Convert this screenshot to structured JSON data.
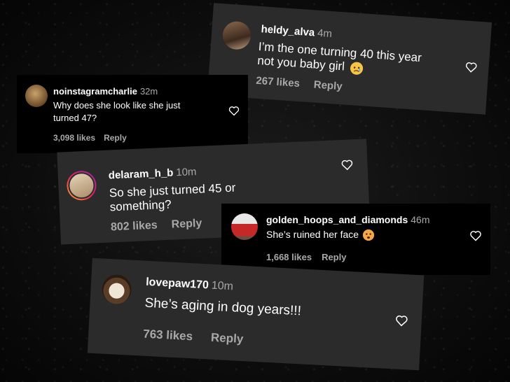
{
  "comments": [
    {
      "user": "heldy_alva",
      "time": "4m",
      "line1": "I’m the one turning 40 this year",
      "line2": "not you baby girl",
      "likes": "267 likes",
      "reply": "Reply"
    },
    {
      "user": "noinstagramcharlie",
      "time": "32m",
      "line1": "Why does she look like she just",
      "line2": "turned 47?",
      "likes": "3,098 likes",
      "reply": "Reply"
    },
    {
      "user": "delaram_h_b",
      "time": "10m",
      "line1": "So she just turned 45 or",
      "line2": "something?",
      "likes": "802 likes",
      "reply": "Reply"
    },
    {
      "user": "golden_hoops_and_diamonds",
      "time": "46m",
      "line1": "She’s ruined her face",
      "likes": "1,668 likes",
      "reply": "Reply"
    },
    {
      "user": "lovepaw170",
      "time": "10m",
      "line1": "She’s aging in dog years!!!",
      "likes": "763 likes",
      "reply": "Reply"
    }
  ],
  "icons": [
    "heart-icon",
    "sad-face-emoji",
    "frowning-face-emoji"
  ]
}
